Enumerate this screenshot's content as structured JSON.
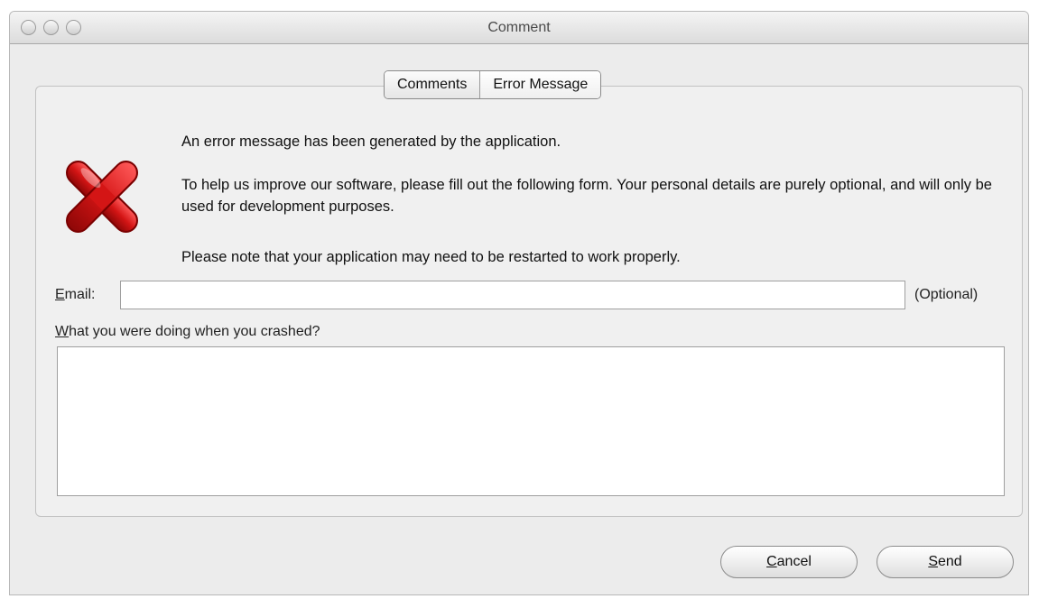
{
  "window": {
    "title": "Comment"
  },
  "tabs": [
    {
      "label": "Comments"
    },
    {
      "label": "Error Message"
    }
  ],
  "icon": {
    "name": "error-x-icon",
    "color": "#cc1111"
  },
  "message": {
    "line1": "An error message has been generated by the application.",
    "line2": "To help us improve our software, please fill out the following form. Your personal details are purely optional, and will only be used for development purposes.",
    "line3": "Please note that your application may need to be restarted to work properly."
  },
  "email": {
    "label_first": "E",
    "label_rest": "mail:",
    "value": "",
    "optional_text": "(Optional)"
  },
  "doing": {
    "label_first": "W",
    "label_rest": "hat you were doing when you crashed?",
    "value": ""
  },
  "buttons": {
    "cancel_first": "C",
    "cancel_rest": "ancel",
    "send_first": "S",
    "send_rest": "end"
  }
}
